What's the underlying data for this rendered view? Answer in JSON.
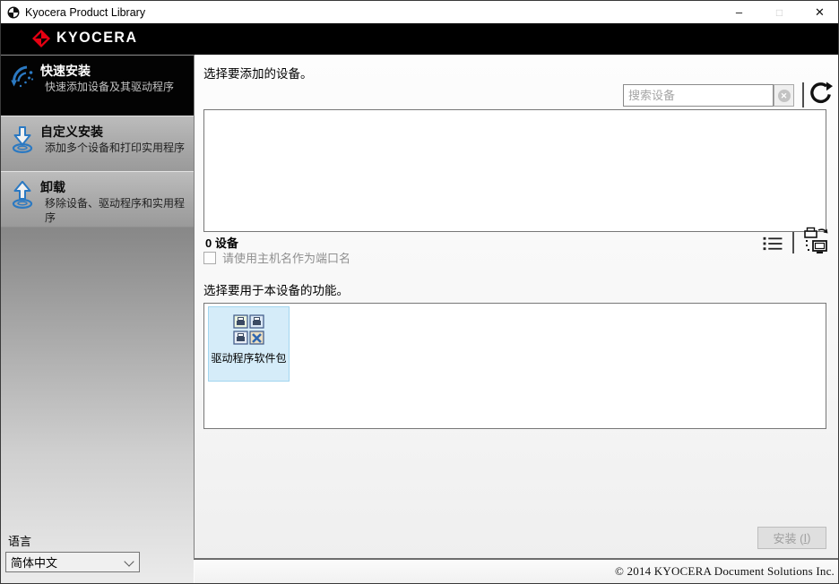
{
  "window": {
    "title": "Kyocera Product Library",
    "controls": {
      "minimize": "–",
      "maximize": "□",
      "close": "✕"
    }
  },
  "brand": {
    "logo_text": "KYOCERA"
  },
  "colors": {
    "brand_red": "#e60012",
    "icon_blue": "#2b79c2",
    "selected_tile_bg": "#d5ecf9",
    "sidebar_selected_bg": "#030303"
  },
  "sidebar": {
    "items": [
      {
        "title": "快速安装",
        "subtitle": "快速添加设备及其驱动程序",
        "selected": true
      },
      {
        "title": "自定义安装",
        "subtitle": "添加多个设备和打印实用程序",
        "selected": false
      },
      {
        "title": "卸载",
        "subtitle": "移除设备、驱动程序和实用程序",
        "selected": false
      }
    ],
    "language": {
      "label": "语言",
      "selected": "简体中文"
    }
  },
  "main": {
    "device_section": {
      "heading": "选择要添加的设备。",
      "search_placeholder": "搜索设备",
      "device_count": "0 设备",
      "hostname_checkbox_label": "请使用主机名作为端口名",
      "hostname_checkbox_checked": false
    },
    "features_section": {
      "heading": "选择要用于本设备的功能。",
      "tiles": [
        {
          "label": "驱动程序软件包",
          "selected": true
        }
      ]
    },
    "install_button": {
      "label_prefix": "安装 (",
      "mnemonic": "I",
      "label_suffix": ")",
      "enabled": false
    }
  },
  "footer": {
    "copyright": "© 2014 KYOCERA Document Solutions Inc."
  }
}
